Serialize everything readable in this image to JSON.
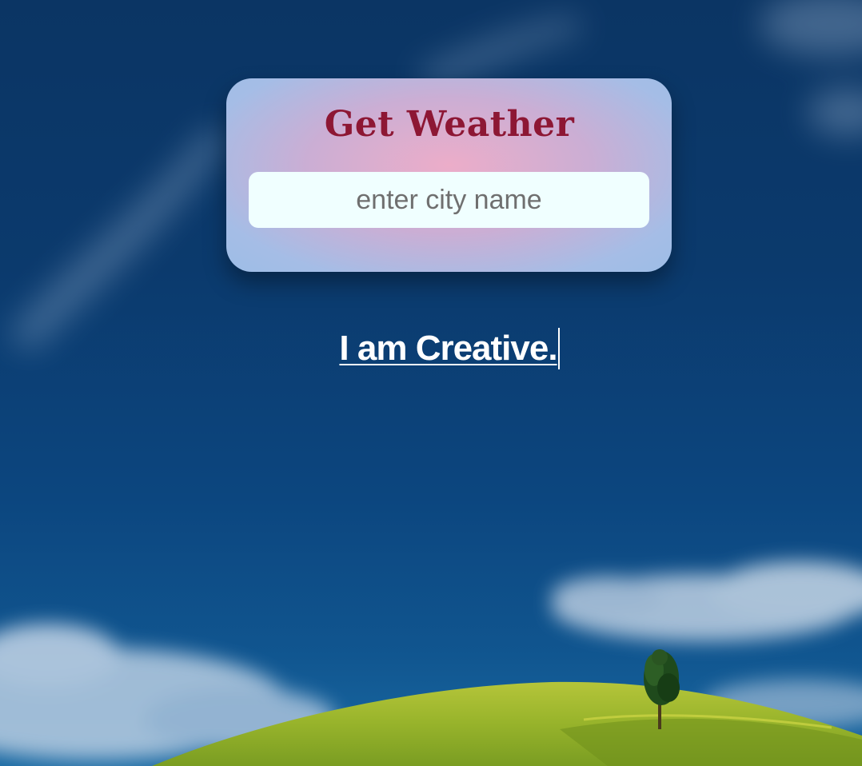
{
  "card": {
    "title": "Get Weather",
    "input_placeholder": "enter city name",
    "input_value": ""
  },
  "tagline": {
    "text": "I am Creative."
  },
  "colors": {
    "title": "#8d1734",
    "input_background": "#f0ffff",
    "sky_top": "#0b3564",
    "sky_bottom": "#1a6aa3",
    "hill": "#9cb52a",
    "tagline": "#ffffff"
  },
  "background": {
    "scene": "blue-sky-green-hill-tree"
  }
}
